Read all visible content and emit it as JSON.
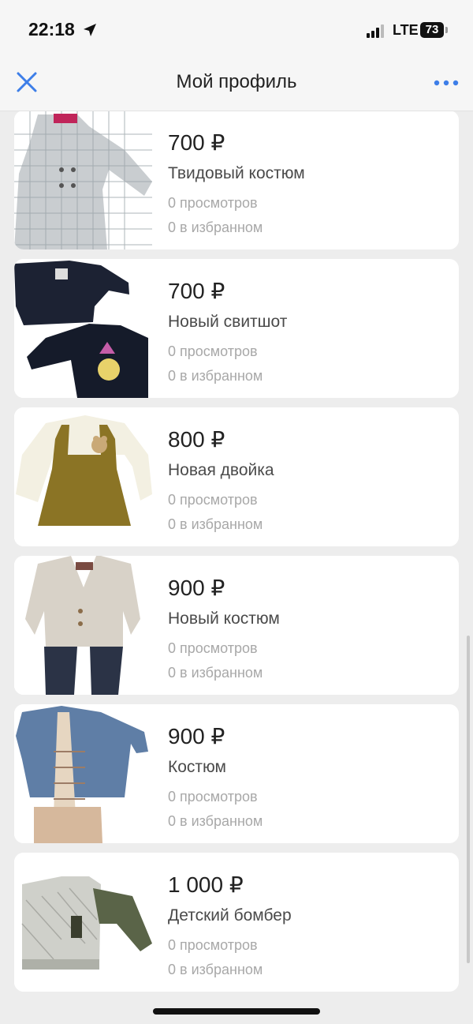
{
  "status_bar": {
    "time": "22:18",
    "network": "LTE",
    "battery": "73"
  },
  "header": {
    "title": "Мой профиль"
  },
  "listings": [
    {
      "price": "700 ₽",
      "title": "Твидовый костюм",
      "views": "0 просмотров",
      "favorites": "0 в избранном",
      "image": "tweed-suit-image"
    },
    {
      "price": "700 ₽",
      "title": "Новый свитшот",
      "views": "0 просмотров",
      "favorites": "0 в избранном",
      "image": "sweatshirt-image"
    },
    {
      "price": "800 ₽",
      "title": "Новая двойка",
      "views": "0 просмотров",
      "favorites": "0 в избранном",
      "image": "dress-set-image"
    },
    {
      "price": "900 ₽",
      "title": "Новый костюм",
      "views": "0 просмотров",
      "favorites": "0 в избранном",
      "image": "blazer-suit-image"
    },
    {
      "price": "900 ₽",
      "title": "Костюм",
      "views": "0 просмотров",
      "favorites": "0 в избранном",
      "image": "denim-suit-image"
    },
    {
      "price": "1 000 ₽",
      "title": "Детский бомбер",
      "views": "0 просмотров",
      "favorites": "0 в избранном",
      "image": "bomber-image"
    }
  ],
  "colors": {
    "accent": "#3d7ee8",
    "background": "#ededed",
    "card": "#ffffff",
    "muted_text": "#a8a8a8"
  }
}
